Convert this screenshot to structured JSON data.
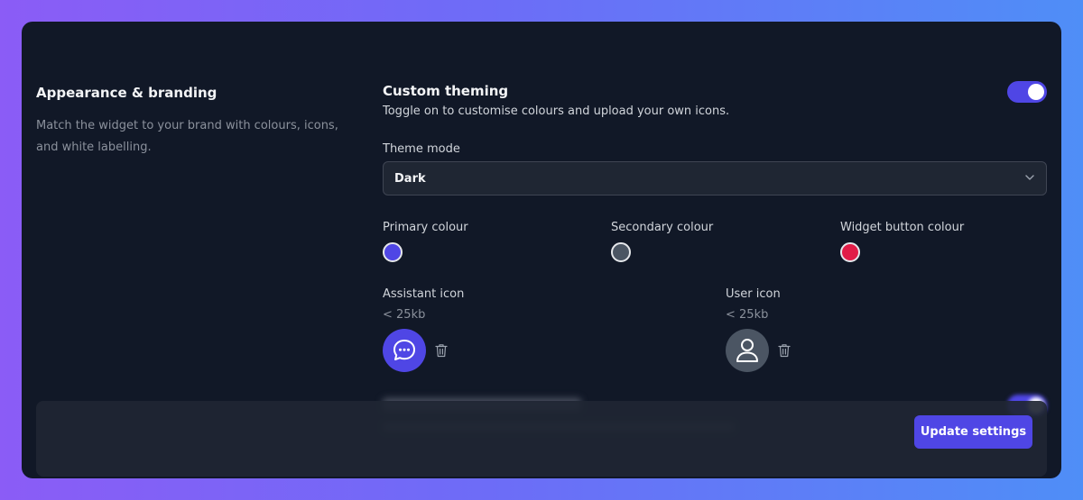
{
  "appearance": {
    "title": "Appearance & branding",
    "description": "Match the widget to your brand with colours, icons, and white labelling."
  },
  "custom_theming": {
    "title": "Custom theming",
    "description": "Toggle on to customise colours and upload your own icons.",
    "enabled": true
  },
  "theme_mode": {
    "label": "Theme mode",
    "value": "Dark"
  },
  "colours": {
    "primary": {
      "label": "Primary colour",
      "color": "#4f46e5"
    },
    "secondary": {
      "label": "Secondary colour",
      "color": "#4b5563"
    },
    "widget_button": {
      "label": "Widget button colour",
      "color": "#e11d48"
    }
  },
  "icons": {
    "assistant": {
      "label": "Assistant icon",
      "size_hint": "< 25kb",
      "icon": "chat-bubble-icon",
      "bg": "#4f46e5"
    },
    "user": {
      "label": "User icon",
      "size_hint": "< 25kb",
      "icon": "user-icon",
      "bg": "#4b5563"
    }
  },
  "footer": {
    "update_label": "Update settings"
  }
}
